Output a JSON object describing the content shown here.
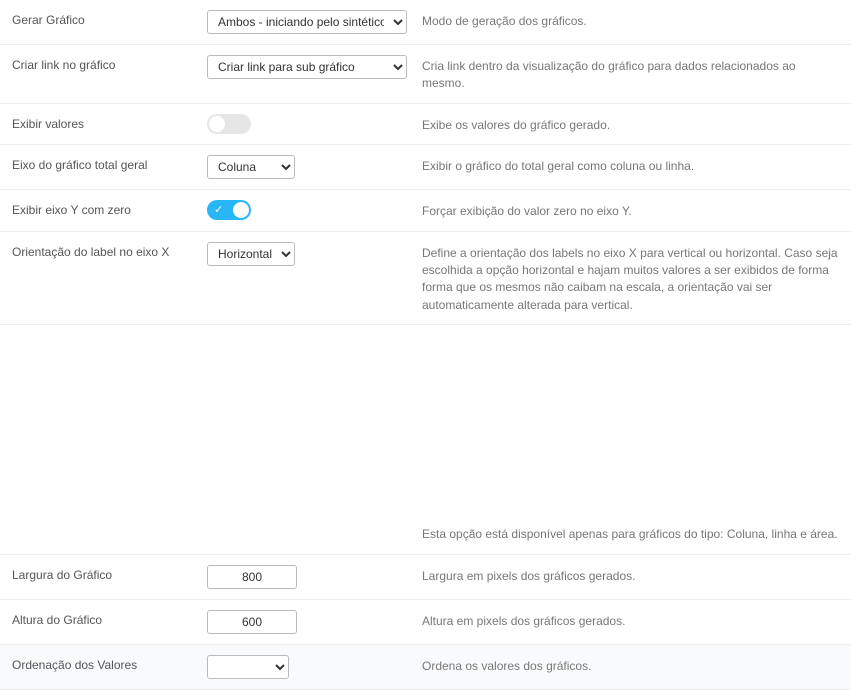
{
  "rows": {
    "r0": {
      "label": "Gerar Gráfico",
      "value": "Ambos - iniciando pelo sintético",
      "desc": "Modo de geração dos gráficos."
    },
    "r1": {
      "label": "Criar link no gráfico",
      "value": "Criar link para sub gráfico",
      "desc": "Cria link dentro da visualização do gráfico para dados relacionados ao mesmo."
    },
    "r2": {
      "label": "Exibir valores",
      "desc": "Exibe os valores do gráfico gerado."
    },
    "r3": {
      "label": "Eixo do gráfico total geral",
      "value": "Coluna",
      "desc": "Exibir o gráfico do total geral como coluna ou linha."
    },
    "r4": {
      "label": "Exibir eixo Y com zero",
      "desc": "Forçar exibição do valor zero no eixo Y."
    },
    "r5": {
      "label": "Orientação do label no eixo X",
      "value": "Horizontal",
      "desc": "Define a orientação dos labels no eixo X para vertical ou horizontal. Caso seja escolhida a opção horizontal e hajam muitos valores a ser exibidos de forma forma que os mesmos não caibam na escala, a orientação vai ser automaticamente alterada para vertical."
    },
    "note": "Esta opção está disponível apenas para gráficos do tipo: Coluna, linha e área.",
    "r6": {
      "label": "Largura do Gráfico",
      "value": "800",
      "desc": "Largura em pixels dos gráficos gerados."
    },
    "r7": {
      "label": "Altura do Gráfico",
      "value": "600",
      "desc": "Altura em pixels dos gráficos gerados."
    },
    "r8": {
      "label": "Ordenação dos Valores",
      "value": "",
      "desc": "Ordena os valores dos gráficos."
    }
  }
}
